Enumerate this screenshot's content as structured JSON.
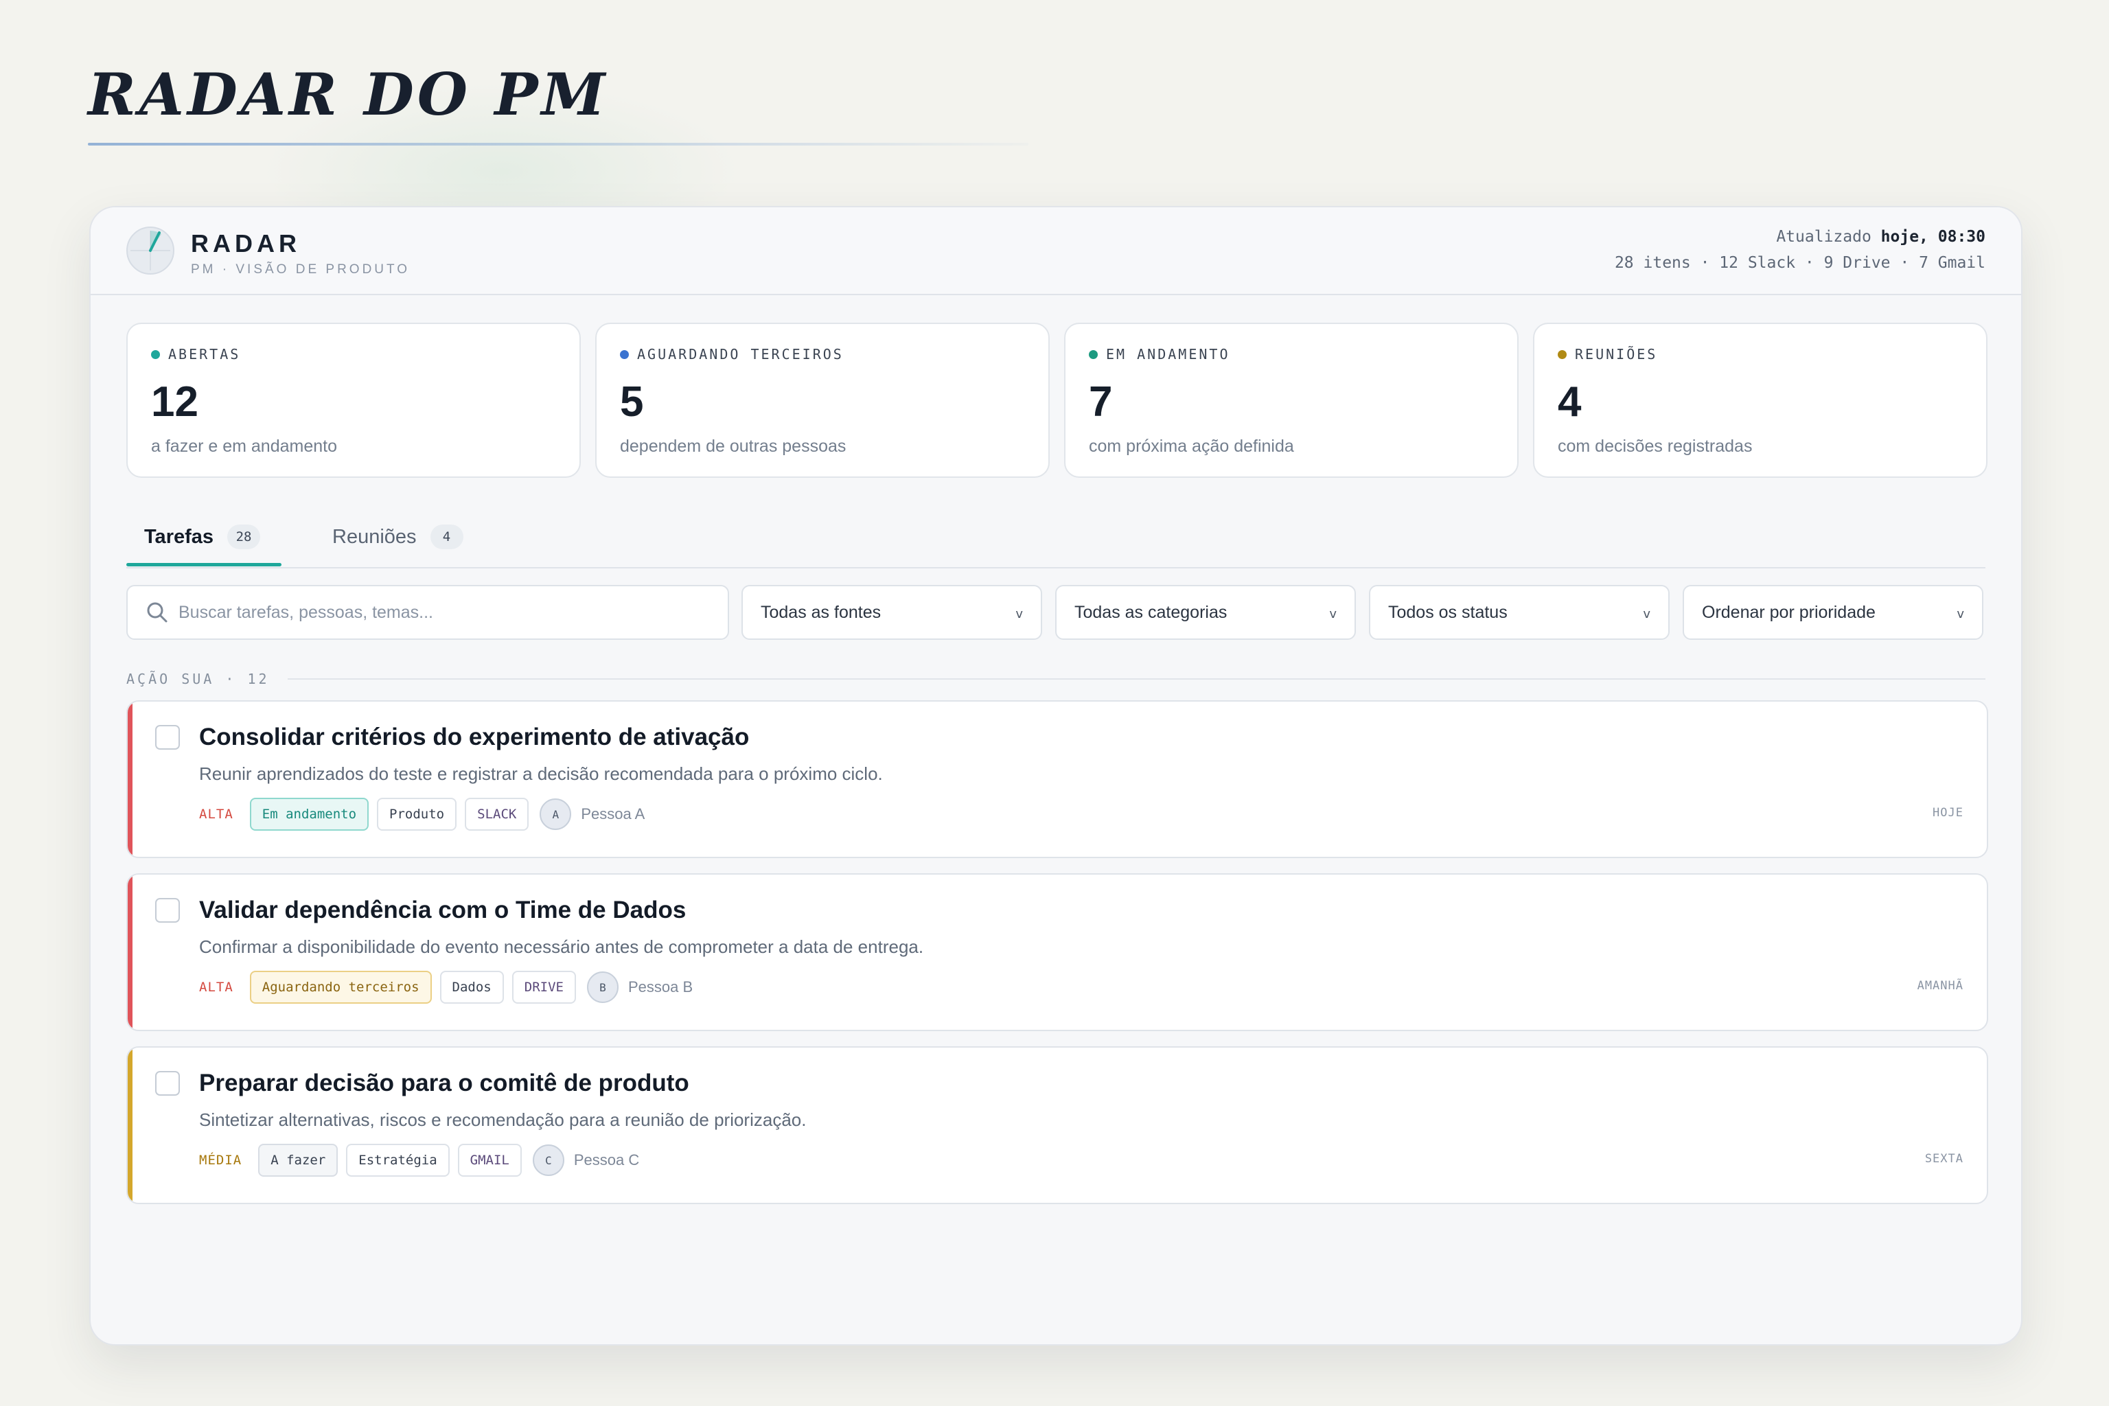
{
  "page": {
    "title": "RADAR DO PM"
  },
  "app": {
    "name": "RADAR",
    "subtitle": "PM · VISÃO DE PRODUTO",
    "updated_prefix": "Atualizado",
    "updated_value": "hoje, 08:30",
    "counts": "28 itens · 12 Slack · 9 Drive · 7 Gmail"
  },
  "stats": [
    {
      "label": "ABERTAS",
      "value": "12",
      "desc": "a fazer e em andamento",
      "color": "#1fa79b"
    },
    {
      "label": "AGUARDANDO TERCEIROS",
      "value": "5",
      "desc": "dependem de outras pessoas",
      "color": "#3b73d0"
    },
    {
      "label": "EM ANDAMENTO",
      "value": "7",
      "desc": "com próxima ação definida",
      "color": "#1c9a80"
    },
    {
      "label": "REUNIÕES",
      "value": "4",
      "desc": "com decisões registradas",
      "color": "#b08a14"
    }
  ],
  "tabs": [
    {
      "label": "Tarefas",
      "count": "28",
      "active": true
    },
    {
      "label": "Reuniões",
      "count": "4",
      "active": false
    }
  ],
  "filters": {
    "search_placeholder": "Buscar tarefas, pessoas, temas...",
    "search_icon": "search-icon",
    "sources": "Todas as fontes",
    "categories": "Todas as categorias",
    "status": "Todos os status",
    "sort": "Ordenar por prioridade",
    "chevron": "v"
  },
  "section": {
    "label": "AÇÃO SUA · 12"
  },
  "tasks": [
    {
      "title": "Consolidar critérios do experimento de ativação",
      "desc": "Reunir aprendizados do teste e registrar a decisão recomendada para o próximo ciclo.",
      "priority": "ALTA",
      "priority_color": "#d4493f",
      "bar_color": "#e0545a",
      "status": "Em andamento",
      "status_color": "#17897c",
      "status_bg": "#e8f7f5",
      "status_border": "#8fd8ce",
      "category": "Produto",
      "source": "SLACK",
      "avatar": "A",
      "person": "Pessoa A",
      "due": "HOJE"
    },
    {
      "title": "Validar dependência com o Time de Dados",
      "desc": "Confirmar a disponibilidade do evento necessário antes de comprometer a data de entrega.",
      "priority": "ALTA",
      "priority_color": "#d4493f",
      "bar_color": "#e0545a",
      "status": "Aguardando terceiros",
      "status_color": "#8a6410",
      "status_bg": "#fdf7e6",
      "status_border": "#ebcf85",
      "category": "Dados",
      "source": "DRIVE",
      "avatar": "B",
      "person": "Pessoa B",
      "due": "AMANHÃ"
    },
    {
      "title": "Preparar decisão para o comitê de produto",
      "desc": "Sintetizar alternativas, riscos e recomendação para a reunião de priorização.",
      "priority": "MÉDIA",
      "priority_color": "#a7780c",
      "bar_color": "#d4a72c",
      "status": "A fazer",
      "status_color": "#384150",
      "status_bg": "#f4f6f8",
      "status_border": "#d8dde4",
      "category": "Estratégia",
      "source": "GMAIL",
      "avatar": "C",
      "person": "Pessoa C",
      "due": "SEXTA"
    }
  ]
}
